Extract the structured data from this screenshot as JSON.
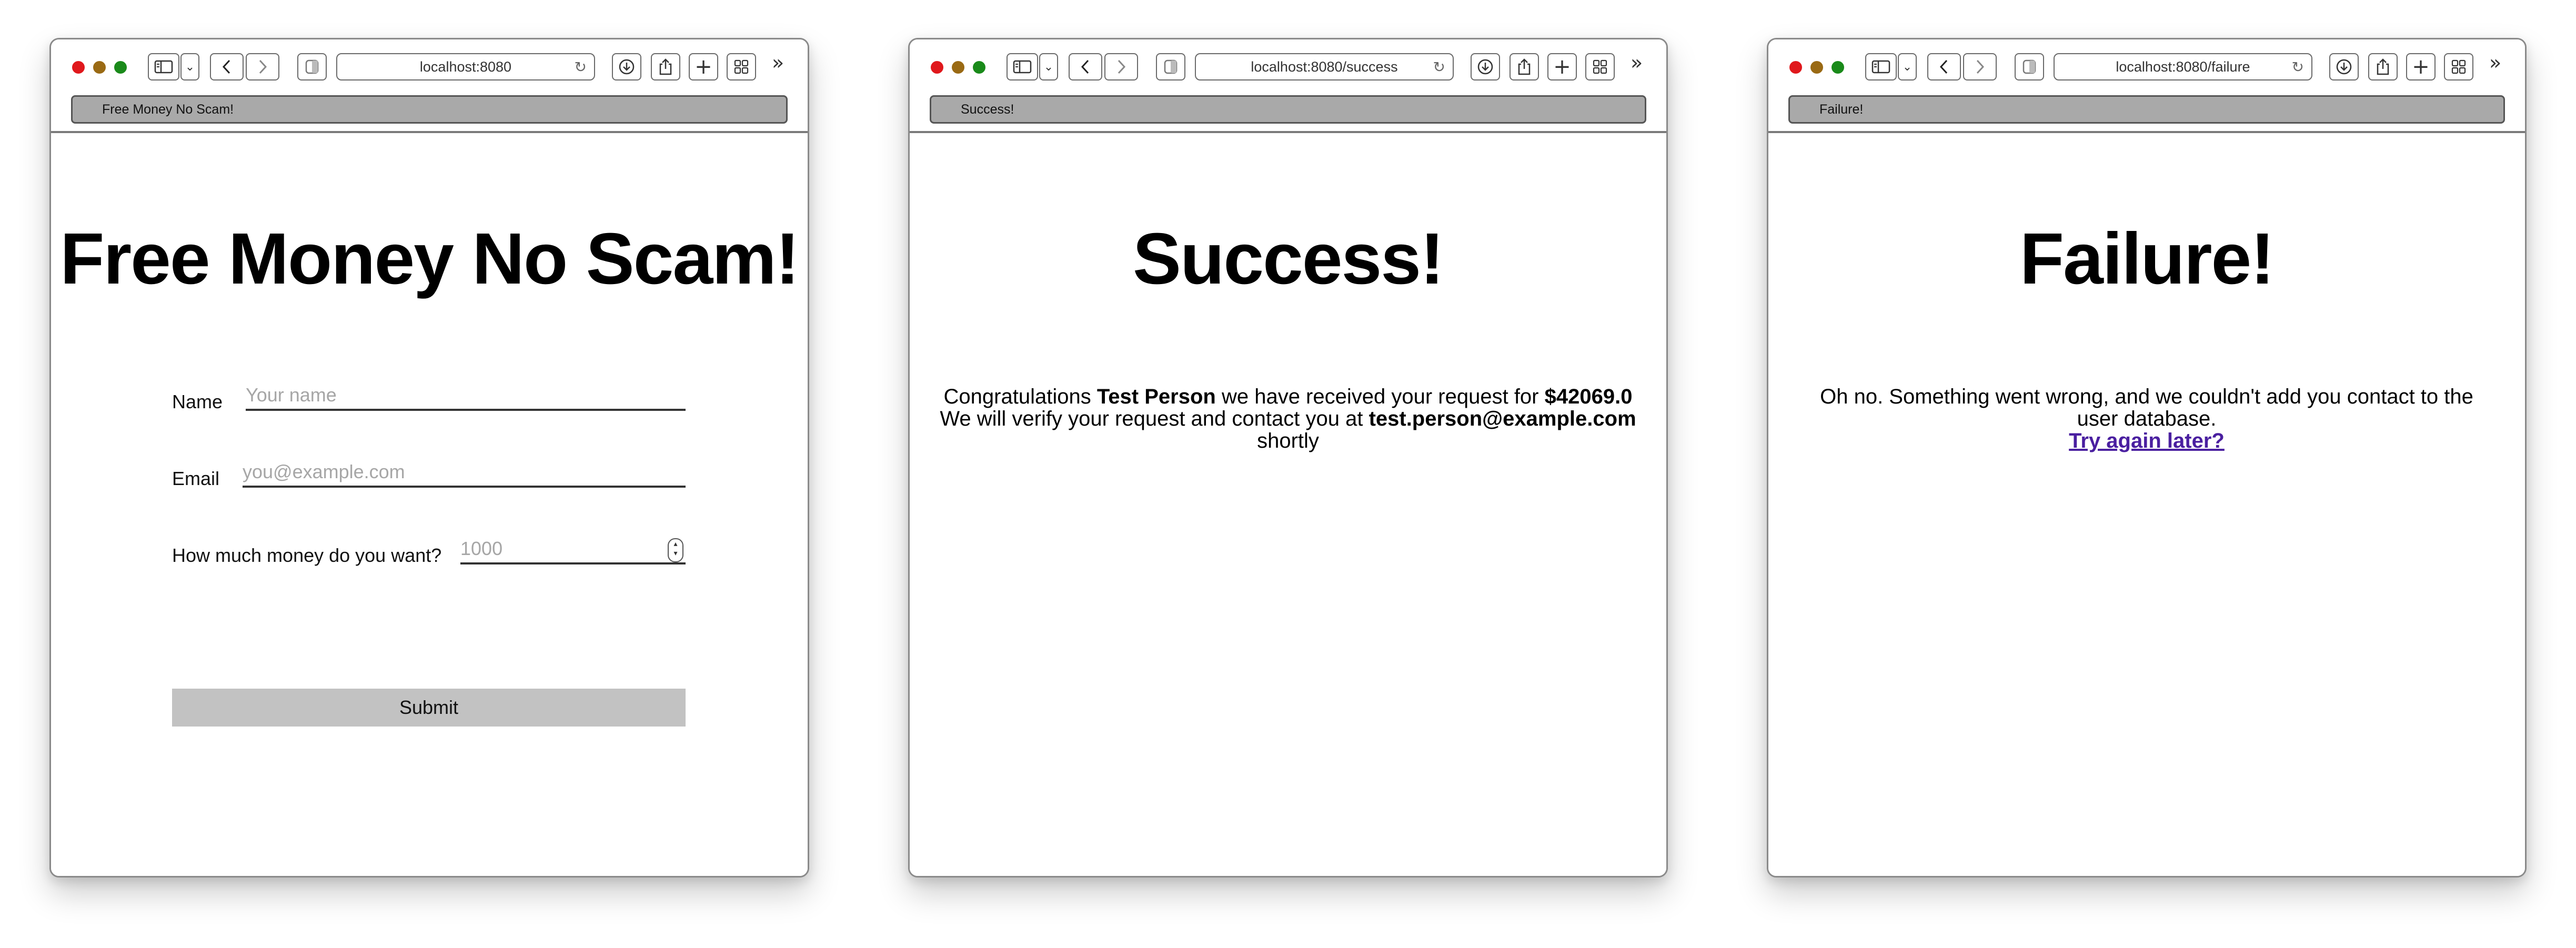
{
  "windows": [
    {
      "url": "localhost:8080",
      "tab_title": "Free Money No Scam!",
      "heading": "Free Money No Scam!",
      "form": {
        "name_label": "Name",
        "name_placeholder": "Your name",
        "email_label": "Email",
        "email_placeholder": "you@example.com",
        "amount_label": "How much money do you want?",
        "amount_placeholder": "1000",
        "submit_label": "Submit"
      }
    },
    {
      "url": "localhost:8080/success",
      "tab_title": "Success!",
      "heading": "Success!",
      "message": {
        "prefix": "Congratulations ",
        "name": "Test Person",
        "middle": " we have received your request for ",
        "amount": "$42069.0",
        "line2_prefix": "We will verify your request and contact you at ",
        "email": "test.person@example.com",
        "line3": "shortly"
      }
    },
    {
      "url": "localhost:8080/failure",
      "tab_title": "Failure!",
      "heading": "Failure!",
      "message": {
        "text": "Oh no. Something went wrong, and we couldn't add you contact to the user database.",
        "link": "Try again later?"
      }
    }
  ],
  "colors": {
    "close": "#e0181c",
    "minimize": "#9a6a14",
    "zoom": "#1a8a1a",
    "tab_bg": "#a9a9a9",
    "submit_bg": "#c2c2c2",
    "link": "#4a1fa0"
  },
  "icons": {
    "sidebar": "sidebar-icon",
    "back": "chevron-left-icon",
    "forward": "chevron-right-icon",
    "shield": "shield-icon",
    "reload": "reload-icon",
    "download": "download-icon",
    "share": "share-icon",
    "new_tab": "plus-icon",
    "tab_overview": "grid-icon",
    "overflow": "double-chevron-icon"
  }
}
